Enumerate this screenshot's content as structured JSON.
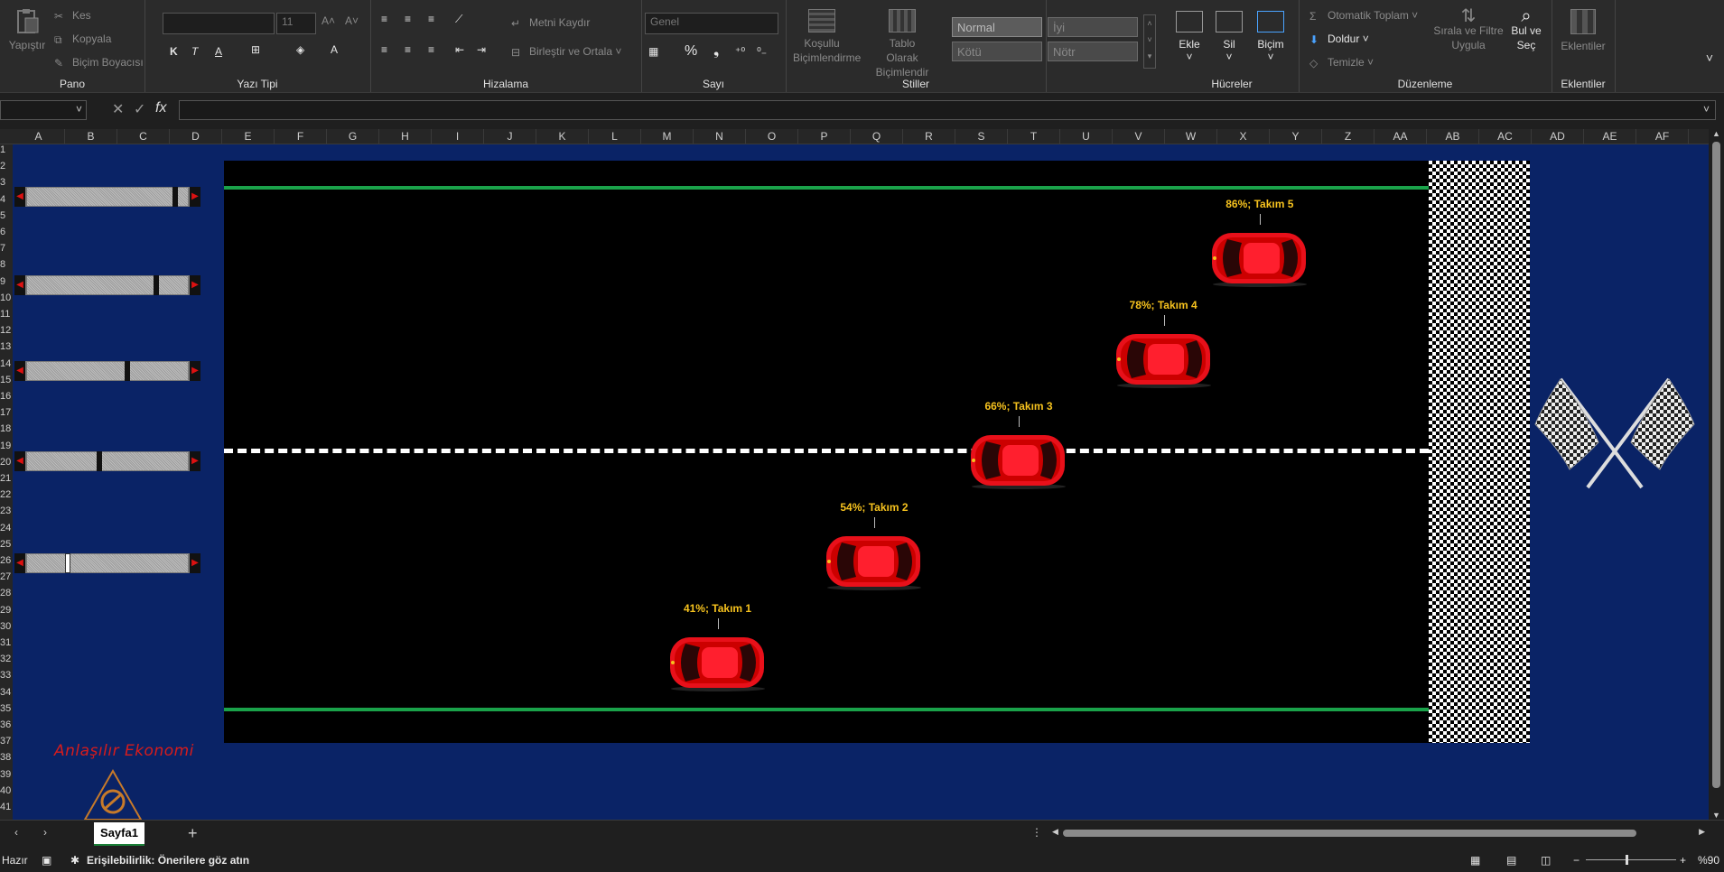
{
  "ribbon": {
    "pano": {
      "title": "Pano",
      "paste": "Yapıştır",
      "cut": "Kes",
      "copy": "Kopyala",
      "format_painter": "Biçim Boyacısı"
    },
    "font": {
      "title": "Yazı Tipi",
      "font_name": "",
      "font_size": "11",
      "bold": "K",
      "italic": "T",
      "underline": "A"
    },
    "alignment": {
      "title": "Hizalama",
      "wrap_text": "Metni Kaydır",
      "merge_center": "Birleştir ve Ortala"
    },
    "number": {
      "title": "Sayı",
      "format": "Genel",
      "percent": "%",
      "comma": "❟"
    },
    "styles": {
      "title": "Stiller",
      "conditional": "Koşullu Biçimlendirme",
      "format_table": "Tablo Olarak Biçimlendir",
      "normal": "Normal",
      "good": "İyi",
      "bad": "Kötü",
      "neutral": "Nötr"
    },
    "cells": {
      "title": "Hücreler",
      "insert": "Ekle",
      "delete": "Sil",
      "format": "Biçim"
    },
    "editing": {
      "title": "Düzenleme",
      "autosum": "Otomatik Toplam",
      "fill": "Doldur",
      "clear": "Temizle",
      "sort_filter": "Sırala ve Filtre Uygula",
      "find_select": "Bul ve Seç"
    },
    "addins": {
      "title": "Eklentiler",
      "addins": "Eklentiler"
    }
  },
  "formula_bar": {
    "fx": "fx"
  },
  "columns": [
    "A",
    "B",
    "C",
    "D",
    "E",
    "F",
    "G",
    "H",
    "I",
    "J",
    "K",
    "L",
    "M",
    "N",
    "O",
    "P",
    "Q",
    "R",
    "S",
    "T",
    "U",
    "V",
    "W",
    "X",
    "Y",
    "Z",
    "AA",
    "AB",
    "AC",
    "AD",
    "AE",
    "AF"
  ],
  "rows": [
    "1",
    "2",
    "3",
    "4",
    "5",
    "6",
    "7",
    "8",
    "9",
    "10",
    "11",
    "12",
    "13",
    "14",
    "15",
    "16",
    "17",
    "18",
    "19",
    "20",
    "21",
    "22",
    "23",
    "24",
    "25",
    "26",
    "27",
    "28",
    "29",
    "30",
    "31",
    "32",
    "33",
    "34",
    "35",
    "36",
    "37",
    "38",
    "39",
    "40",
    "41"
  ],
  "race": {
    "teams": [
      {
        "label": "41%; Takım 1",
        "percent": 41
      },
      {
        "label": "54%; Takım 2",
        "percent": 54
      },
      {
        "label": "66%; Takım 3",
        "percent": 66
      },
      {
        "label": "78%; Takım 4",
        "percent": 78
      },
      {
        "label": "86%; Takım 5",
        "percent": 86
      }
    ],
    "car_color": "#e8101a",
    "lane_color": "#1aa24a",
    "background": "#0a2366"
  },
  "scrollbars": [
    {
      "name": "Takım 5",
      "value": 0.86
    },
    {
      "name": "Takım 4",
      "value": 0.78
    },
    {
      "name": "Takım 3",
      "value": 0.66
    },
    {
      "name": "Takım 2",
      "value": 0.54
    },
    {
      "name": "Takım 1",
      "value": 0.41
    }
  ],
  "brand": "Anlaşılır Ekonomi",
  "sheet_tab": "Sayfa1",
  "status": {
    "ready": "Hazır",
    "accessibility": "Erişilebilirlik: Önerilere göz atın",
    "zoom": "%90"
  }
}
